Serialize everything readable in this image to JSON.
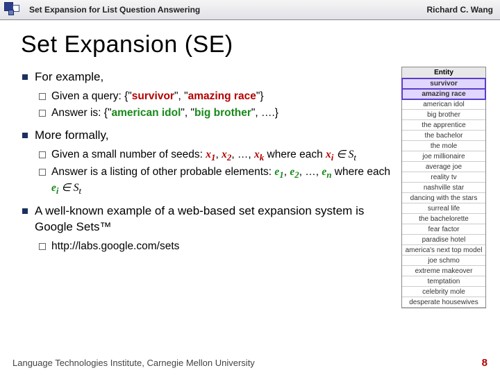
{
  "header": {
    "title": "Set Expansion for List Question Answering",
    "author": "Richard C. Wang"
  },
  "slide_title": "Set Expansion (SE)",
  "bullets": {
    "b1": "For example,",
    "b1a_pre": "Given a query: {\"",
    "b1a_s1": "survivor",
    "b1a_mid": "\", \"",
    "b1a_s2": "amazing race",
    "b1a_post": "\"}",
    "b1b_pre": "Answer is: {\"",
    "b1b_e1": "american idol",
    "b1b_mid": "\", \"",
    "b1b_e2": "big brother",
    "b1b_post": "\", ….}",
    "b2": "More formally,",
    "b2a_pre": "Given a small number of seeds: ",
    "b2a_x1": "x",
    "b2a_x1s": "1",
    "b2a_c1": ", ",
    "b2a_x2": "x",
    "b2a_x2s": "2",
    "b2a_c2": ", …, ",
    "b2a_xk": "x",
    "b2a_xks": "k",
    "b2a_where": " where each ",
    "b2a_xi": "x",
    "b2a_xis": "i",
    "b2a_in": " ∈ ",
    "b2a_St": "S",
    "b2a_Sts": "t",
    "b2b_pre": "Answer is a listing of other probable elements: ",
    "b2b_e1": "e",
    "b2b_e1s": "1",
    "b2b_c1": ", ",
    "b2b_e2": "e",
    "b2b_e2s": "2",
    "b2b_c2": ", …, ",
    "b2b_en": "e",
    "b2b_ens": "n",
    "b2b_where": " where each ",
    "b2b_ei": "e",
    "b2b_eis": "i",
    "b2b_in": " ∈ ",
    "b2b_St": "S",
    "b2b_Sts": "t",
    "b3": "A well-known example of a web-based set expansion system is Google Sets™",
    "b3a": "http://labs.google.com/sets"
  },
  "entity_table": {
    "header": "Entity",
    "rows": [
      "survivor",
      "amazing race",
      "american idol",
      "big brother",
      "the apprentice",
      "the bachelor",
      "the mole",
      "joe millionaire",
      "average joe",
      "reality tv",
      "nashville star",
      "dancing with the stars",
      "surreal life",
      "the bachelorette",
      "fear factor",
      "paradise hotel",
      "america's next top model",
      "joe schmo",
      "extreme makeover",
      "temptation",
      "celebrity mole",
      "desperate housewives"
    ],
    "hl": [
      0,
      1
    ]
  },
  "footer": {
    "inst": "Language Technologies Institute, Carnegie Mellon University",
    "page": "8"
  }
}
